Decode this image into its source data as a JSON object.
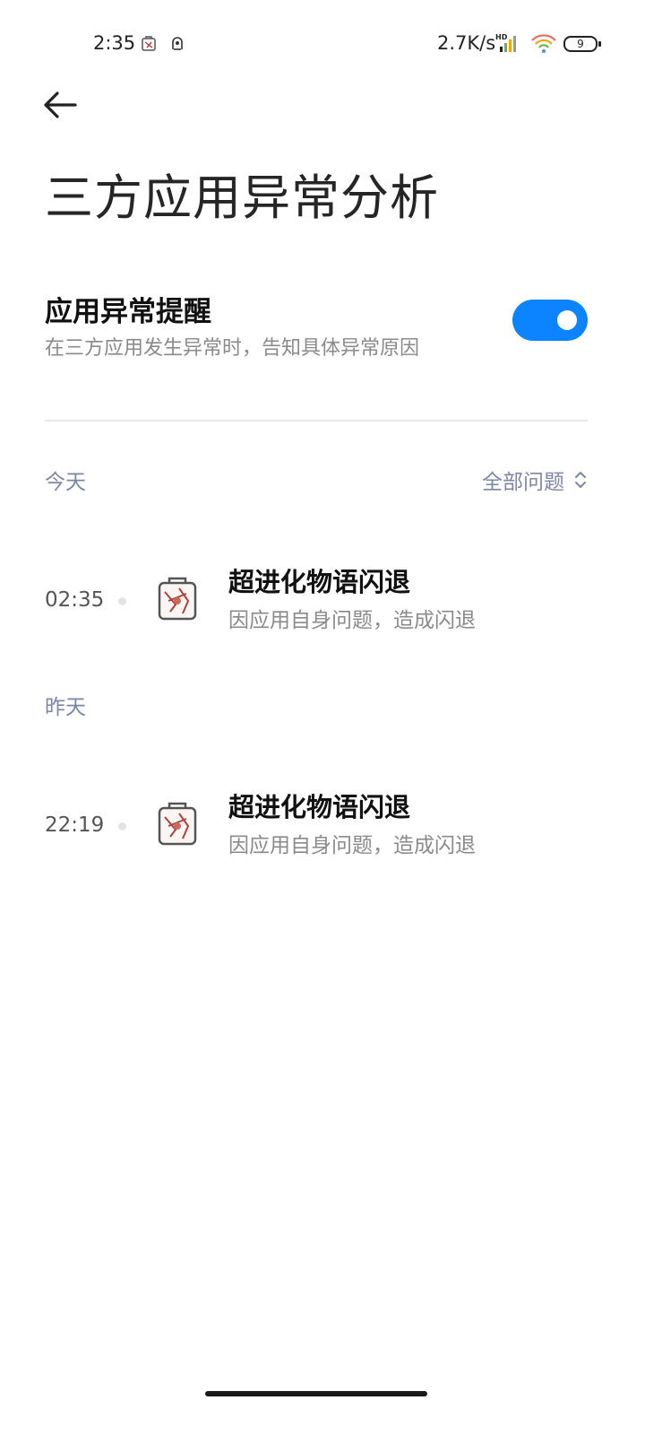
{
  "status_bar": {
    "time": "2:35",
    "network_speed": "2.7K/s",
    "hd_label": "HD",
    "battery": "9"
  },
  "header": {
    "back_icon": "arrow-left-icon",
    "title": "三方应用异常分析"
  },
  "setting": {
    "title": "应用异常提醒",
    "subtitle": "在三方应用发生异常时，告知具体异常原因",
    "enabled": true,
    "accent_color": "#0d84ff"
  },
  "filter": {
    "label": "全部问题",
    "icon": "chevron-up-down-icon"
  },
  "groups": [
    {
      "label": "今天",
      "events": [
        {
          "time": "02:35",
          "title": "超进化物语闪退",
          "subtitle": "因应用自身问题，造成闪退",
          "icon": "app-icon"
        }
      ]
    },
    {
      "label": "昨天",
      "events": [
        {
          "time": "22:19",
          "title": "超进化物语闪退",
          "subtitle": "因应用自身问题，造成闪退",
          "icon": "app-icon"
        }
      ]
    }
  ]
}
